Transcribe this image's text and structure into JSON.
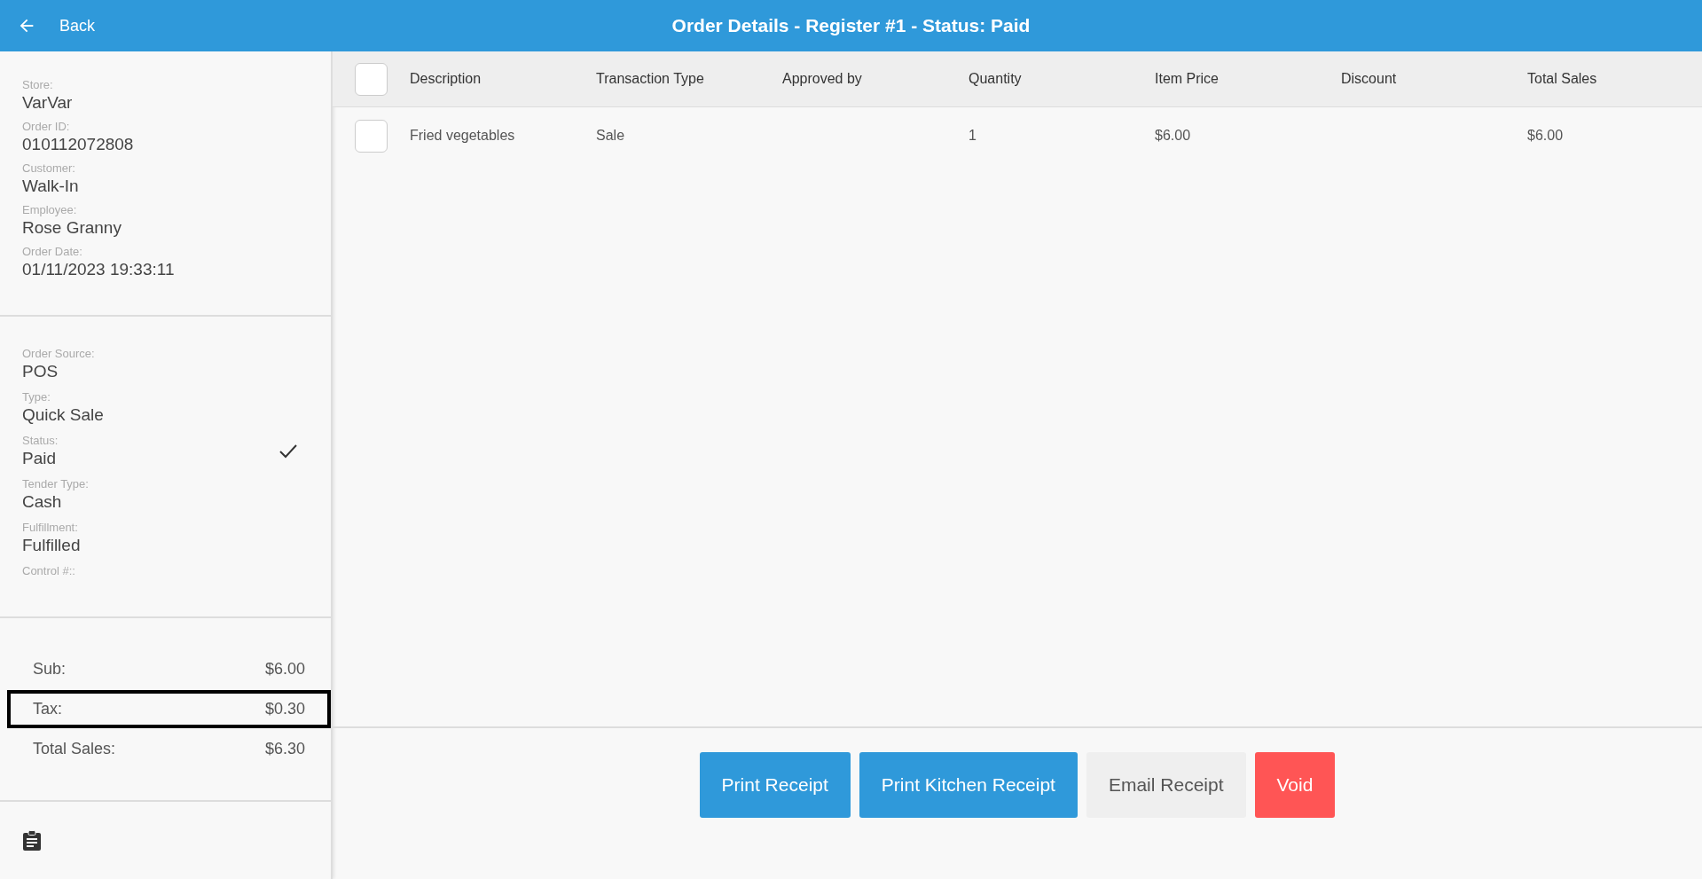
{
  "header": {
    "back_label": "Back",
    "title": "Order Details - Register #1 - Status: Paid"
  },
  "details": [
    {
      "label": "Store:",
      "value": "VarVar"
    },
    {
      "label": "Order ID:",
      "value": "010112072808"
    },
    {
      "label": "Customer:",
      "value": "Walk-In"
    },
    {
      "label": "Employee:",
      "value": "Rose Granny"
    },
    {
      "label": "Order Date:",
      "value": "01/11/2023 19:33:11"
    }
  ],
  "order_info": [
    {
      "label": "Order Source:",
      "value": "POS",
      "checked": false
    },
    {
      "label": "Type:",
      "value": "Quick Sale",
      "checked": false
    },
    {
      "label": "Status:",
      "value": "Paid",
      "checked": true
    },
    {
      "label": "Tender Type:",
      "value": "Cash",
      "checked": false
    },
    {
      "label": "Fulfillment:",
      "value": "Fulfilled",
      "checked": false
    },
    {
      "label": "Control #::",
      "checked": false
    }
  ],
  "totals": [
    {
      "label": "Sub:",
      "value": "$6.00",
      "highlighted": false
    },
    {
      "label": "Tax:",
      "value": "$0.30",
      "highlighted": true
    },
    {
      "label": "Total Sales:",
      "value": "$6.30",
      "highlighted": false
    }
  ],
  "table": {
    "select_all_checked": false,
    "columns": [
      "Description",
      "Transaction Type",
      "Approved by",
      "Quantity",
      "Item Price",
      "Discount",
      "Total Sales"
    ],
    "rows": [
      {
        "checked": false,
        "cells": [
          "Fried vegetables",
          "Sale",
          "",
          "1",
          "$6.00",
          "",
          "$6.00"
        ]
      }
    ]
  },
  "buttons": [
    {
      "label": "Print Receipt",
      "kind": "primary"
    },
    {
      "label": "Print Kitchen Receipt",
      "kind": "primary"
    },
    {
      "label": "Email Receipt",
      "kind": "secondary"
    },
    {
      "label": "Void",
      "kind": "danger"
    }
  ]
}
